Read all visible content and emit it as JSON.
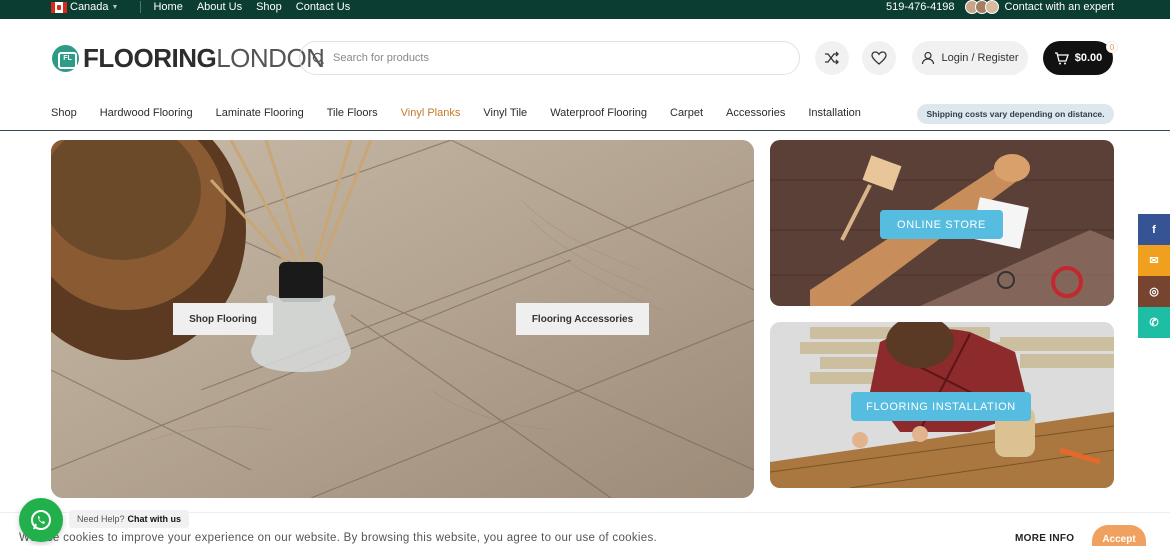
{
  "topbar": {
    "country": "Canada",
    "nav": [
      "Home",
      "About Us",
      "Shop",
      "Contact Us"
    ],
    "phone": "519-476-4198",
    "expert": "Contact with an expert"
  },
  "header": {
    "logo_bold": "FLOORING",
    "logo_light": "LONDON",
    "search_placeholder": "Search for products",
    "login_label": "Login / Register",
    "cart_total": "$0.00",
    "cart_count": "0"
  },
  "mainnav": {
    "items": [
      "Shop",
      "Hardwood Flooring",
      "Laminate Flooring",
      "Tile Floors",
      "Vinyl Planks",
      "Vinyl Tile",
      "Waterproof Flooring",
      "Carpet",
      "Accessories",
      "Installation"
    ],
    "active_index": 4,
    "shipping_note": "Shipping costs vary depending on distance."
  },
  "hero": {
    "btn_left": "Shop Flooring",
    "btn_right": "Flooring Accessories"
  },
  "panels": {
    "top_label": "ONLINE STORE",
    "bottom_label": "FLOORING INSTALLATION"
  },
  "social": [
    {
      "icon": "facebook-icon",
      "glyph": "f",
      "color": "#365493"
    },
    {
      "icon": "email-icon",
      "glyph": "✉",
      "color": "#f0a01e"
    },
    {
      "icon": "instagram-icon",
      "glyph": "◎",
      "color": "#774430"
    },
    {
      "icon": "whatsapp-icon",
      "glyph": "✆",
      "color": "#1ebea5"
    }
  ],
  "chat": {
    "prefix": "Need Help?",
    "link": "Chat with us"
  },
  "cookie": {
    "text": "We use cookies to improve your experience on our website. By browsing this website, you agree to our use of cookies.",
    "more_info": "MORE INFO",
    "accept": "Accept"
  },
  "colors": {
    "topbar_bg": "#0b3d33",
    "accent_active": "#c47a2c",
    "panel_button": "#56bde0",
    "accept_button": "#f0a15f"
  }
}
